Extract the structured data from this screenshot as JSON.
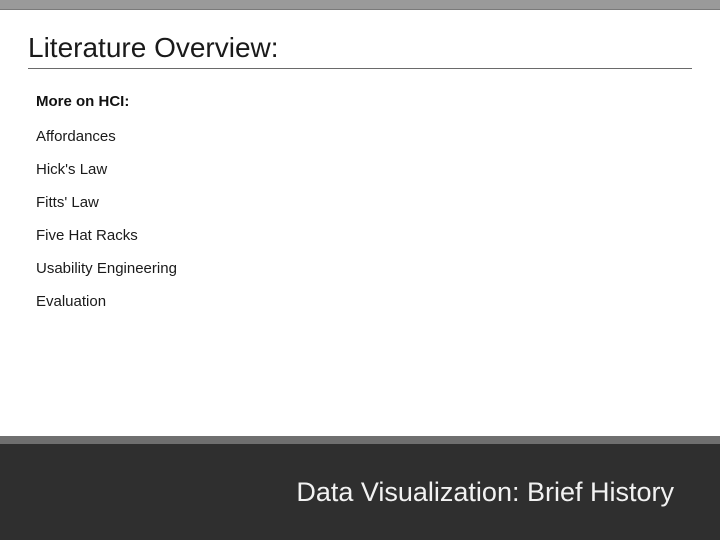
{
  "header": {
    "title": "Literature Overview:"
  },
  "section": {
    "subheading": "More on HCI:",
    "items": [
      "Affordances",
      "Hick's Law",
      "Fitts' Law",
      "Five Hat Racks",
      "Usability Engineering",
      "Evaluation"
    ]
  },
  "footer": {
    "title": "Data Visualization: Brief History"
  }
}
